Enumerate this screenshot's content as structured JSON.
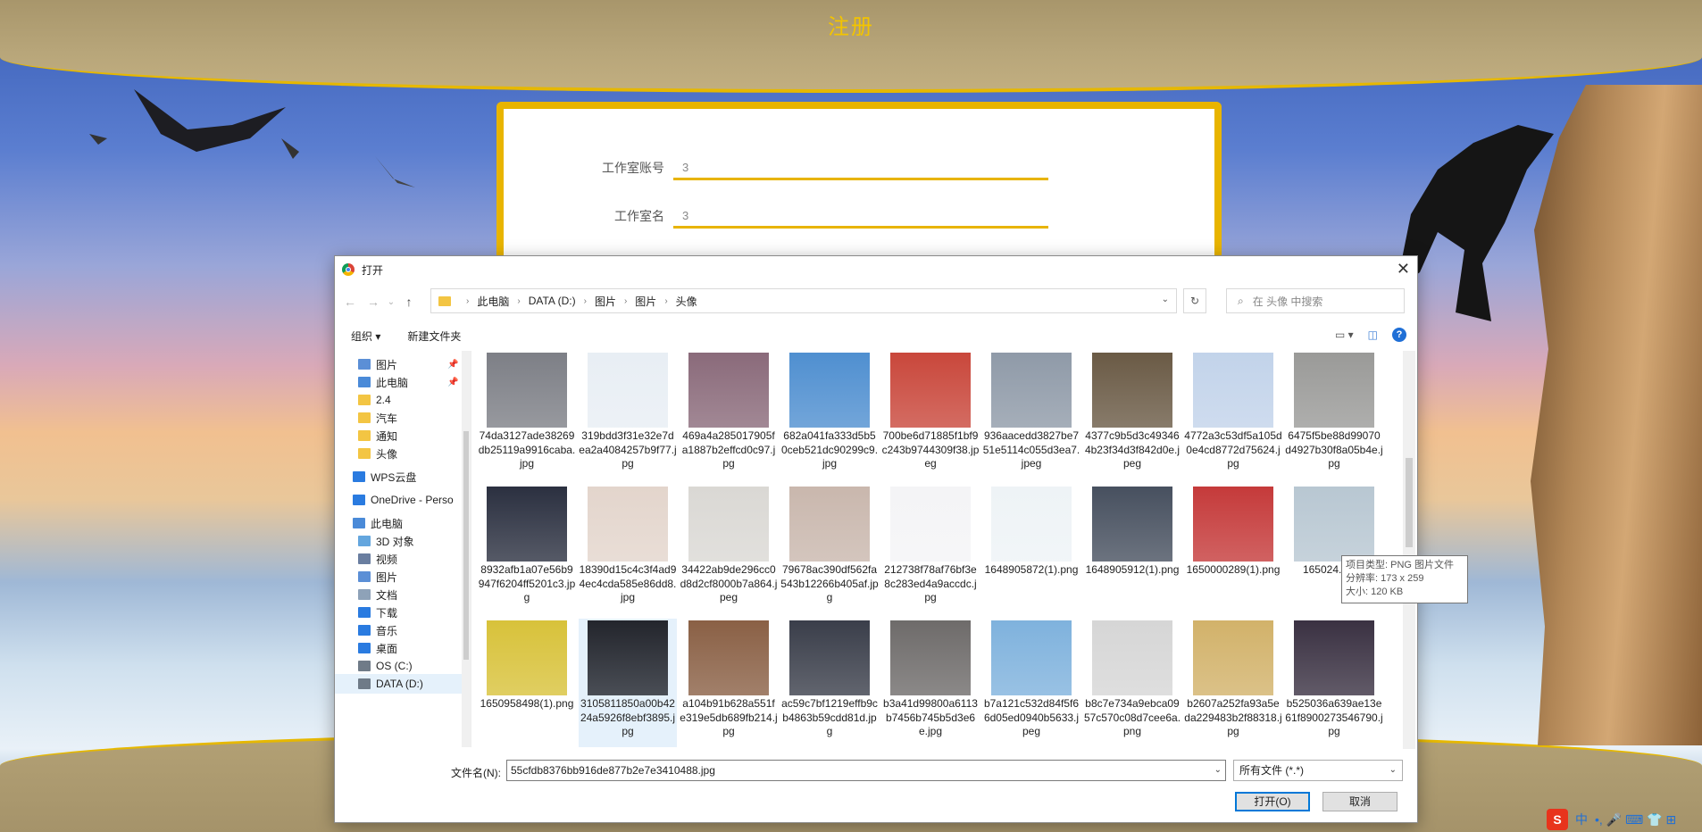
{
  "page": {
    "title": "注册"
  },
  "form": {
    "fields": [
      {
        "label": "工作室账号",
        "value": "3"
      },
      {
        "label": "工作室名",
        "value": "3"
      }
    ]
  },
  "dialog": {
    "title": "打开",
    "close": "✕",
    "nav": {
      "back": "←",
      "forward": "→",
      "recent": "⌄",
      "up": "↑"
    },
    "breadcrumb": [
      "此电脑",
      "DATA (D:)",
      "图片",
      "图片",
      "头像"
    ],
    "search_placeholder": "在 头像 中搜索",
    "refresh": "↻",
    "toolbar": {
      "organize": "组织 ▾",
      "new_folder": "新建文件夹",
      "help": "?"
    },
    "sidebar": [
      {
        "label": "图片",
        "icon": "pictures-icon",
        "pinned": true
      },
      {
        "label": "此电脑",
        "icon": "computer-icon",
        "pinned": true
      },
      {
        "label": "2.4",
        "icon": "folder-icon"
      },
      {
        "label": "汽车",
        "icon": "folder-icon"
      },
      {
        "label": "通知",
        "icon": "folder-icon"
      },
      {
        "label": "头像",
        "icon": "folder-icon"
      },
      {
        "label": "WPS云盘",
        "icon": "cloud-icon"
      },
      {
        "label": "OneDrive - Perso",
        "icon": "cloud-icon"
      },
      {
        "label": "此电脑",
        "icon": "computer-icon"
      },
      {
        "label": "3D 对象",
        "icon": "3d-icon"
      },
      {
        "label": "视频",
        "icon": "video-icon"
      },
      {
        "label": "图片",
        "icon": "pictures-icon"
      },
      {
        "label": "文档",
        "icon": "documents-icon"
      },
      {
        "label": "下载",
        "icon": "download-icon"
      },
      {
        "label": "音乐",
        "icon": "music-icon"
      },
      {
        "label": "桌面",
        "icon": "desktop-icon"
      },
      {
        "label": "OS (C:)",
        "icon": "drive-icon"
      },
      {
        "label": "DATA (D:)",
        "icon": "drive-icon"
      }
    ],
    "files": [
      {
        "name": "74da3127ade38269db25119a9916caba.jpg",
        "color": "#7d7f86"
      },
      {
        "name": "319bdd3f31e32e7dea2a4084257b9f77.jpg",
        "color": "#e8eef4"
      },
      {
        "name": "469a4a285017905fa1887b2effcd0c97.jpg",
        "color": "#8a6a7a"
      },
      {
        "name": "682a041fa333d5b50ceb521dc90299c9.jpg",
        "color": "#4f8fd0"
      },
      {
        "name": "700be6d71885f1bf9c243b9744309f38.jpeg",
        "color": "#c9473b"
      },
      {
        "name": "936aacedd3827be751e5114c055d3ea7.jpeg",
        "color": "#8f9aa8"
      },
      {
        "name": "4377c9b5d3c493464b23f34d3f842d0e.jpeg",
        "color": "#6a5a45"
      },
      {
        "name": "4772a3c53df5a105d0e4cd8772d75624.jpg",
        "color": "#c2d3ea"
      },
      {
        "name": "6475f5be88d99070d4927b30f8a05b4e.jpg",
        "color": "#9a9a98"
      },
      {
        "name": "8932afb1a07e56b9947f6204ff5201c3.jpg",
        "color": "#2b3040"
      },
      {
        "name": "18390d15c4c3f4ad94ec4cda585e86dd8.jpg",
        "color": "#e3d5cc"
      },
      {
        "name": "34422ab9de296cc0d8d2cf8000b7a864.jpeg",
        "color": "#dad8d4"
      },
      {
        "name": "79678ac390df562fa543b12266b405af.jpg",
        "color": "#c9b7ad"
      },
      {
        "name": "212738f78af76bf3e8c283ed4a9accdc.jpg",
        "color": "#f4f4f6"
      },
      {
        "name": "1648905872(1).png",
        "color": "#eef3f6"
      },
      {
        "name": "1648905912(1).png",
        "color": "#47505f"
      },
      {
        "name": "1650000289(1).png",
        "color": "#c53a3a"
      },
      {
        "name": "165024...png",
        "color": "#b8c7d2"
      },
      {
        "name": "1650958498(1).png",
        "color": "#d8c23a"
      },
      {
        "name": "3105811850a00b4224a5926f8ebf3895.jpg",
        "color": "#23252c"
      },
      {
        "name": "a104b91b628a551fe319e5db689fb214.jpg",
        "color": "#8a6045"
      },
      {
        "name": "ac59c7bf1219effb9cb4863b59cdd81d.jpg",
        "color": "#3a3e4a"
      },
      {
        "name": "b3a41d99800a6113b7456b745b5d3e6e.jpg",
        "color": "#6e6b6a"
      },
      {
        "name": "b7a121c532d84f5f66d05ed0940b5633.jpeg",
        "color": "#7fb2dd"
      },
      {
        "name": "b8c7e734a9ebca0957c570c08d7cee6a.png",
        "color": "#d6d6d6"
      },
      {
        "name": "b2607a252fa93a5eda229483b2f88318.jpg",
        "color": "#d2b26a"
      },
      {
        "name": "b525036a639ae13e61f8900273546790.jpg",
        "color": "#3a3142"
      }
    ],
    "tooltip": {
      "line1": "项目类型: PNG 图片文件",
      "line2": "分辨率: 173 x 259",
      "line3": "大小: 120 KB"
    },
    "filename_label": "文件名(N):",
    "filename_value": "55cfdb8376bb916de877b2e7e3410488.jpg",
    "filter": "所有文件 (*.*)",
    "open_button": "打开(O)",
    "cancel_button": "取消"
  },
  "ime": {
    "logo": "S",
    "lang": "中",
    "items": "•, 🎤 ⌨ 👕 ⊞"
  },
  "colors": {
    "accent": "#e8b400",
    "header": "#b3a175",
    "title": "#f3c400",
    "primary": "#0078d7"
  }
}
